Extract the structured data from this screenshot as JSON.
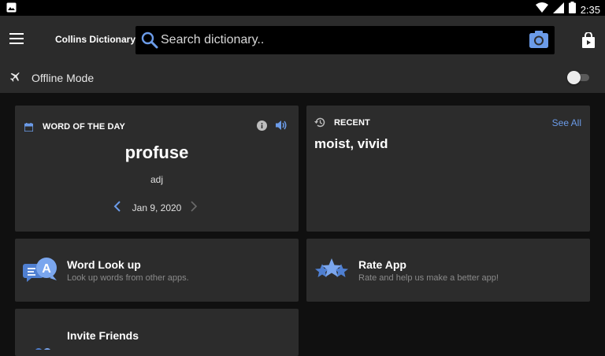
{
  "status_bar": {
    "time": "2:35"
  },
  "toolbar": {
    "title": "Collins Dictionary",
    "search_placeholder": "Search dictionary.."
  },
  "offline": {
    "label": "Offline Mode",
    "enabled": false
  },
  "word_of_the_day": {
    "header": "WORD OF THE DAY",
    "word": "profuse",
    "part_of_speech": "adj",
    "date": "Jan 9, 2020"
  },
  "recent": {
    "header": "RECENT",
    "see_all": "See All",
    "words": "moist, vivid"
  },
  "features": {
    "lookup": {
      "title": "Word Look up",
      "subtitle": "Look up words from other apps."
    },
    "rate": {
      "title": "Rate App",
      "subtitle": "Rate and help us make a better app!"
    },
    "invite": {
      "title": "Invite Friends"
    }
  },
  "colors": {
    "accent": "#6b9be8",
    "background": "#101010",
    "card": "#2c2c2c",
    "toolbar": "#2b2b2b"
  },
  "icons": [
    "image-icon",
    "wifi-icon",
    "signal-icon",
    "battery-icon",
    "menu-icon",
    "search-icon",
    "camera-icon",
    "shopping-bag-icon",
    "airplane-icon",
    "calendar-icon",
    "info-icon",
    "speaker-icon",
    "chevron-left-icon",
    "chevron-right-icon",
    "history-icon",
    "chat-bubbles-icon",
    "stars-icon",
    "people-icon"
  ]
}
